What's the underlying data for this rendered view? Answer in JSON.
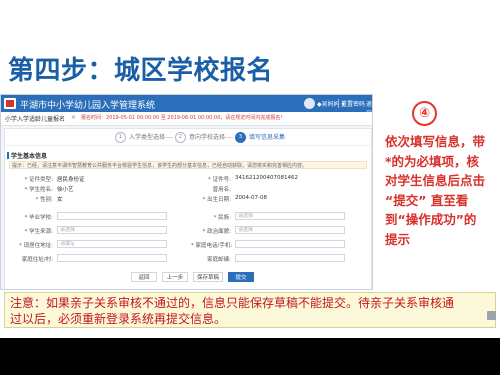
{
  "slide": {
    "title": "第四步：城区学校报名",
    "step_badge": "④",
    "instruction_lines": [
      "依次填写信息，带",
      "*的为必填项，核",
      "对学生信息后点击",
      "“提交” 直至看",
      "到“操作成功”的",
      "提示"
    ],
    "note_lines": [
      "注意：如果亲子关系审核不通过的，信息只能保存草稿不能提交。待亲子关系审核通",
      "过以后，必须重新登录系统再提交信息。"
    ],
    "colors": {
      "title": "#1a5ea6",
      "instruction": "#d8302a",
      "note_text": "#c21818",
      "note_bg": "#fbf9da"
    }
  },
  "app": {
    "title": "平湖市中小学幼儿园入学管理系统",
    "user": "◆吴妈妈 ▾",
    "password_link": "重置密码",
    "exit": "退出",
    "tab": "小学入学适龄儿童报名",
    "tab_close": "×",
    "notice": "报名时间：2019-05-01 00:00:00 至 2019-06-01 00:00:00，请在规定时间内完成报名！",
    "steps": [
      {
        "num": "1",
        "label": "入学类型选择"
      },
      {
        "num": "2",
        "label": "意向学校选择"
      },
      {
        "num": "3",
        "label": "填写信息采集"
      }
    ],
    "section_title": "学生基本信息",
    "hint": "提示：已经，请注意平湖市智慧教育公共服务平台核验学生信息，该学生的部分基本信息，已经自动获取，请您核实和完善相应内容。",
    "fields": [
      {
        "label": "* 证件类型:",
        "value": "居民身份证"
      },
      {
        "label": "* 证件号:",
        "value": "341621200407081462"
      },
      {
        "label": "* 学生姓名:",
        "value": "徐小艺"
      },
      {
        "label": "曾用名:",
        "value": ""
      },
      {
        "label": "* 性别:",
        "value": "女"
      },
      {
        "label": "* 出生日期:",
        "value": "2004-07-08"
      },
      {
        "label": "* 毕业学校:",
        "value": ""
      },
      {
        "label": "* 民族:",
        "value": "请选择"
      },
      {
        "label": "* 学生来源:",
        "value": "请选择"
      },
      {
        "label": "* 政治面貌:",
        "value": "请选择"
      },
      {
        "label": "* 现居住地址:",
        "value": "请填写"
      },
      {
        "label": "* 家庭电话/手机:",
        "value": ""
      },
      {
        "label": "家庭住址/村:",
        "value": ""
      },
      {
        "label": "家庭邮编:",
        "value": ""
      }
    ],
    "buttons": {
      "back": "返回",
      "prev": "上一步",
      "draft": "保存草稿",
      "submit": "提交"
    }
  }
}
